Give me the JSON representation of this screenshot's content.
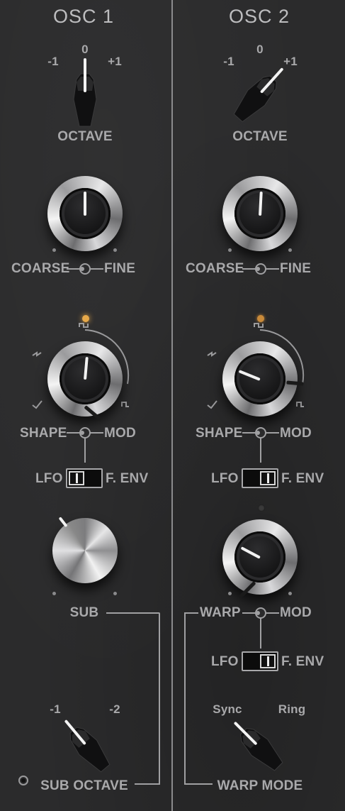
{
  "osc1": {
    "title": "OSC 1",
    "octave": {
      "label": "OCTAVE",
      "minus": "-1",
      "zero": "0",
      "plus": "+1"
    },
    "pitch": {
      "coarse": "COARSE",
      "fine": "FINE"
    },
    "shape": {
      "label": "SHAPE",
      "mod": "MOD"
    },
    "mod_source": {
      "lfo": "LFO",
      "fenv": "F. ENV"
    },
    "sub": {
      "label": "SUB"
    },
    "sub_octave": {
      "label": "SUB OCTAVE",
      "minus1": "-1",
      "minus2": "-2"
    }
  },
  "osc2": {
    "title": "OSC 2",
    "octave": {
      "label": "OCTAVE",
      "minus": "-1",
      "zero": "0",
      "plus": "+1"
    },
    "pitch": {
      "coarse": "COARSE",
      "fine": "FINE"
    },
    "shape": {
      "label": "SHAPE",
      "mod": "MOD"
    },
    "mod_source": {
      "lfo": "LFO",
      "fenv": "F. ENV"
    },
    "warp": {
      "label": "WARP",
      "mod": "MOD"
    },
    "warp_source": {
      "lfo": "LFO",
      "fenv": "F. ENV"
    },
    "warp_mode": {
      "label": "WARP MODE",
      "sync": "Sync",
      "ring": "Ring"
    }
  },
  "colors": {
    "panel": "#2b2b2c",
    "label": "#a9a9ab",
    "led_on": "#e7a94a",
    "led_dim": "#7a5a2a"
  }
}
